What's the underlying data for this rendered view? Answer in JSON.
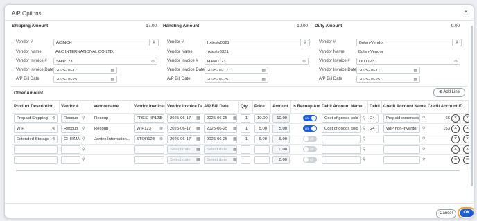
{
  "dialog": {
    "title": "A/P Options",
    "close": "×"
  },
  "sections": [
    {
      "title": "Shipping Amount",
      "amount": "17.00",
      "fields": [
        {
          "label": "Vendor #",
          "value": "ACINCH",
          "kind": "search"
        },
        {
          "label": "Vendor Name",
          "value": "A&C INTERNATIONAL CO.LTD.",
          "kind": "text"
        },
        {
          "label": "Vendor Invoice #",
          "value": "SHIP123",
          "kind": "clear"
        },
        {
          "label": "Vendor Invoice Date",
          "value": "2025-06-17",
          "kind": "date"
        },
        {
          "label": "A/P Bill Date",
          "value": "2025-06-25",
          "kind": "date"
        }
      ]
    },
    {
      "title": "Handling Amount",
      "amount": "10.00",
      "fields": [
        {
          "label": "Vendor #",
          "value": "hxtestv0321",
          "kind": "search"
        },
        {
          "label": "Vendor Name",
          "value": "hxtestv0321",
          "kind": "text"
        },
        {
          "label": "Vendor Invoice #",
          "value": "HAND123",
          "kind": "clear"
        },
        {
          "label": "Vendor Invoice Date",
          "value": "2025-06-17",
          "kind": "date"
        },
        {
          "label": "A/P Bill Date",
          "value": "2025-06-25",
          "kind": "date"
        }
      ]
    },
    {
      "title": "Duty Amount",
      "amount": "9.00",
      "fields": [
        {
          "label": "Vendor #",
          "value": "Bolan-Vendor",
          "kind": "search"
        },
        {
          "label": "Vendor Name",
          "value": "Bolan-Vendor",
          "kind": "text"
        },
        {
          "label": "Vendor Invoice #",
          "value": "DUT123",
          "kind": "clear"
        },
        {
          "label": "Vendor Invoice Date",
          "value": "2025-06-17",
          "kind": "date"
        },
        {
          "label": "A/P Bill Date",
          "value": "2025-06-25",
          "kind": "date"
        }
      ]
    }
  ],
  "other": {
    "title": "Other Amount",
    "add_line": "Add Line"
  },
  "grid": {
    "headers": [
      "Product Description",
      "Vendor #",
      "Vendorname",
      "Vendor Invoice #",
      "Vendor Invoice Date",
      "A/P Bill Date",
      "Qty",
      "Price",
      "Amount",
      "Is Recoup Amount",
      "Debit Account Name",
      "Debit Ac",
      "Credit Account Name",
      "Credit Account ID"
    ],
    "date_placeholder": "Select date",
    "rows": [
      {
        "desc": "Prepaid Shipping",
        "vendor": "Recoup",
        "vendorname": "Recoup",
        "invoice": "PRESHIP123",
        "inv_date": "2025-06-17",
        "bill_date": "2025-06-25",
        "qty": "1",
        "price": "10.00",
        "amount": "10.00",
        "recoup": true,
        "debit_name": "Cost of goods sold",
        "debit_ac": "24",
        "credit_name": "Prepaid expenses",
        "credit_id": "66"
      },
      {
        "desc": "WIP",
        "vendor": "Recoup",
        "vendorname": "Recoup",
        "invoice": "WIP123",
        "inv_date": "2025-06-17",
        "bill_date": "2025-06-25",
        "qty": "1",
        "price": "5.00",
        "amount": "5.00",
        "recoup": true,
        "debit_name": "Cost of goods sold",
        "debit_ac": "24",
        "credit_name": "WIP non-inventor",
        "credit_id": "153"
      },
      {
        "desc": "Extended Storage",
        "vendor": "CHHZJA",
        "vendorname": "Jantex Internation...",
        "invoice": "STOR123",
        "inv_date": "2025-06-17",
        "bill_date": "2025-06-25",
        "qty": "1",
        "price": "6.00",
        "amount": "6.00",
        "recoup": false,
        "debit_name": "",
        "debit_ac": "",
        "credit_name": "",
        "credit_id": ""
      },
      {
        "desc": "",
        "vendor": "",
        "vendorname": "",
        "invoice": "",
        "inv_date": "",
        "bill_date": "",
        "qty": "",
        "price": "",
        "amount": "0.00",
        "recoup": false,
        "debit_name": "",
        "debit_ac": "",
        "credit_name": "",
        "credit_id": ""
      },
      {
        "desc": "",
        "vendor": "",
        "vendorname": "",
        "invoice": "",
        "inv_date": "",
        "bill_date": "",
        "qty": "",
        "price": "",
        "amount": "0.00",
        "recoup": false,
        "debit_name": "",
        "debit_ac": "",
        "credit_name": "",
        "credit_id": ""
      }
    ],
    "toggle_on": "on",
    "toggle_off": "off"
  },
  "footer": {
    "cancel": "Cancel",
    "ok": "OK"
  },
  "colors": {
    "accent": "#1f5fd6",
    "focus": "#f2a23a"
  }
}
